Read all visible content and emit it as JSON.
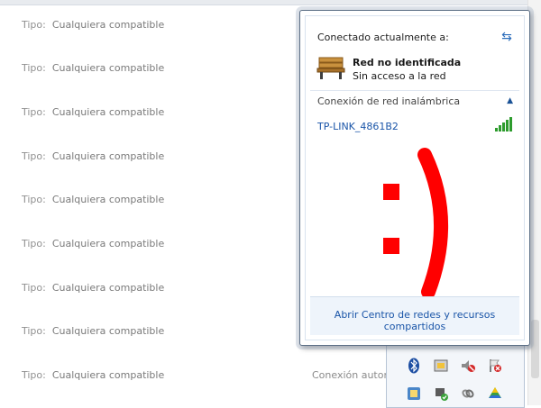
{
  "background_list": {
    "rows": [
      {
        "key": "Tipo:",
        "value": "Cualquiera compatible"
      },
      {
        "key": "Tipo:",
        "value": "Cualquiera compatible"
      },
      {
        "key": "Tipo:",
        "value": "Cualquiera compatible"
      },
      {
        "key": "Tipo:",
        "value": "Cualquiera compatible"
      },
      {
        "key": "Tipo:",
        "value": "Cualquiera compatible"
      },
      {
        "key": "Tipo:",
        "value": "Cualquiera compatible"
      },
      {
        "key": "Tipo:",
        "value": "Cualquiera compatible"
      },
      {
        "key": "Tipo:",
        "value": "Cualquiera compatible"
      },
      {
        "key": "Tipo:",
        "value": "Cualquiera compatible"
      }
    ],
    "partial_label": "Conexión autom"
  },
  "flyout": {
    "header": "Conectado actualmente a:",
    "network_name": "Red no identificada",
    "network_status": "Sin acceso a la red",
    "wireless_section": "Conexión de red inalámbrica",
    "ssid": "TP-LINK_4861B2",
    "signal_bars": 5,
    "footer_link": "Abrir Centro de redes y recursos compartidos",
    "emoticon": ":)"
  },
  "tray_icons": [
    "bluetooth-icon",
    "device-icon",
    "volume-muted-icon",
    "flag-error-icon",
    "app-icon",
    "usb-device-icon",
    "link-icon",
    "drive-icon"
  ],
  "colors": {
    "accent": "#1a55a8",
    "smile": "#ff0000",
    "signal": "#2e9c2e"
  }
}
